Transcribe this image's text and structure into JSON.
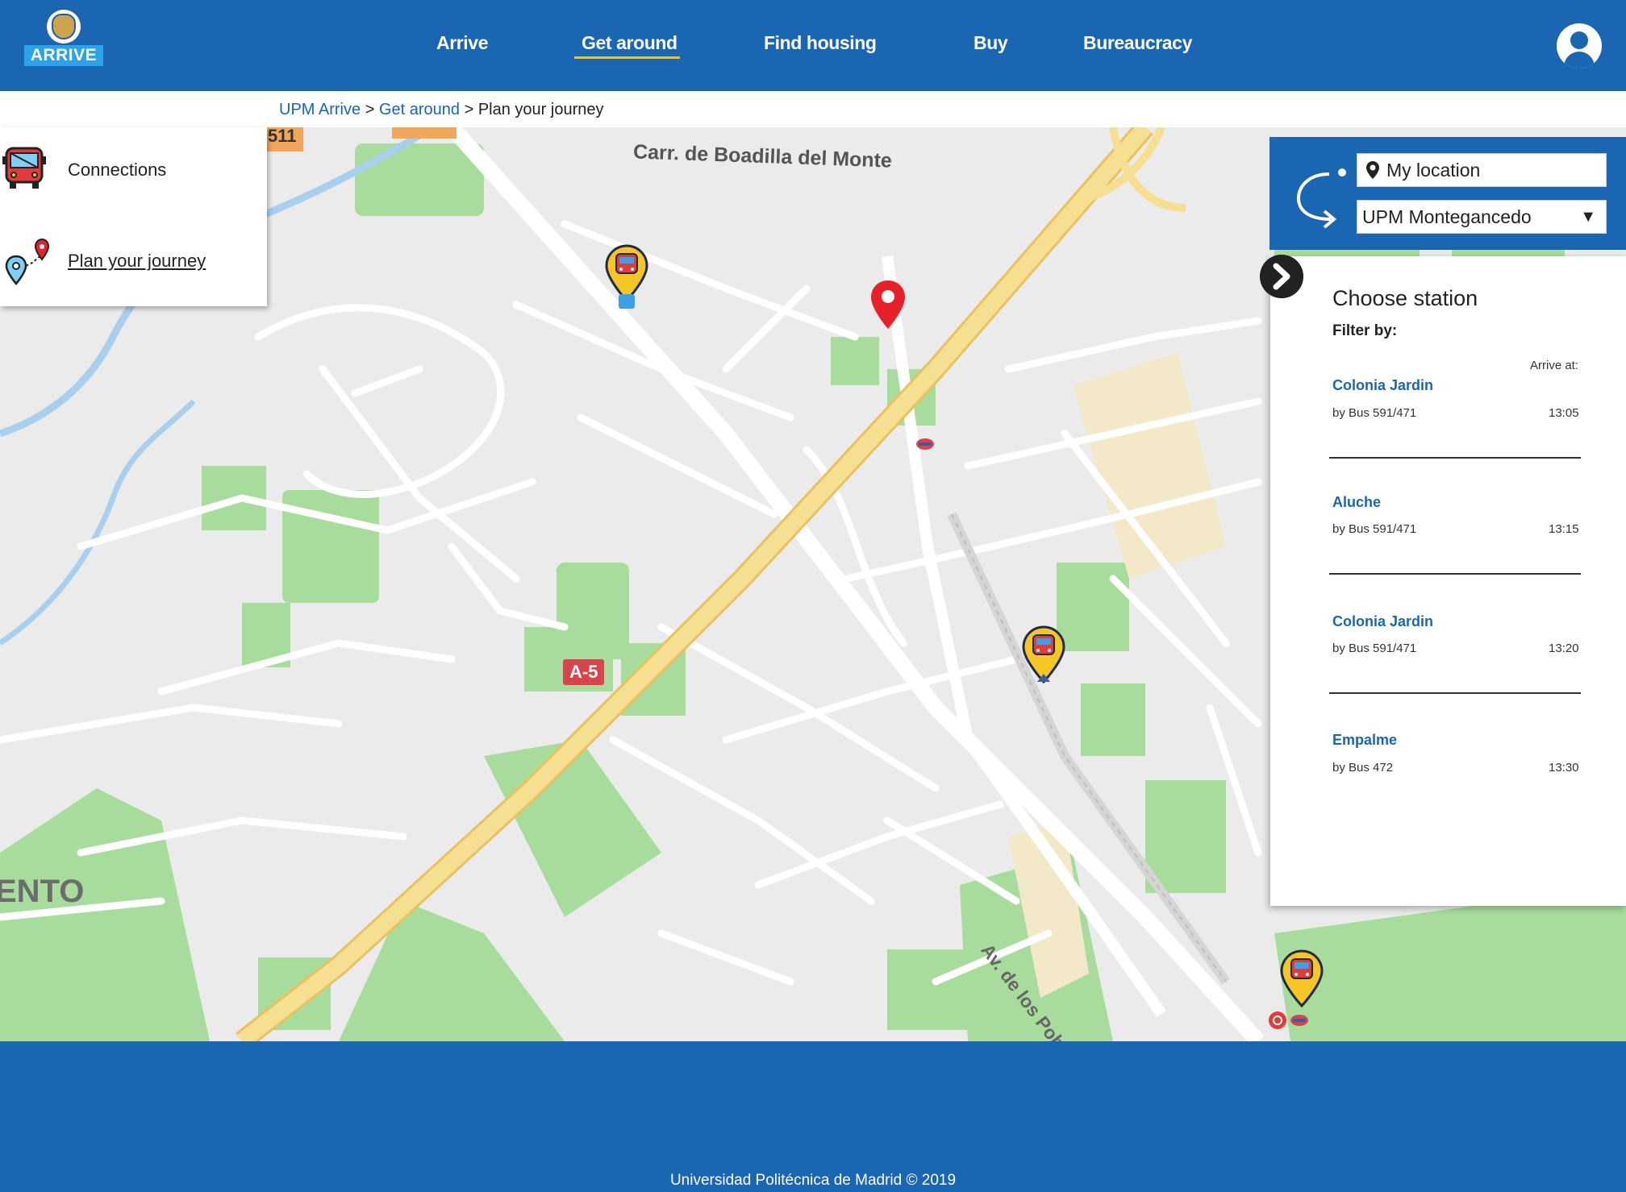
{
  "header": {
    "logo_text": "ARRIVE",
    "nav": [
      "Arrive",
      "Get around",
      "Find housing",
      "Buy",
      "Bureaucracy"
    ],
    "active_nav": "Get around"
  },
  "breadcrumb": {
    "items": [
      "UPM Arrive",
      "Get around",
      "Plan your journey"
    ],
    "separator": ">"
  },
  "left_menu": {
    "items": [
      {
        "label": "Connections",
        "icon": "bus-icon"
      },
      {
        "label": "Plan your journey",
        "icon": "route-pins-icon"
      }
    ]
  },
  "map": {
    "labels": {
      "street_top": "Carr. de Boadilla del Monte",
      "street_diag": "Av. de los Poblados",
      "area_left": "ENTO",
      "road_a5": "A-5",
      "road_511": "511"
    },
    "markers": [
      "train-station-pin-icon",
      "location-pin-icon"
    ]
  },
  "route": {
    "origin": "My location",
    "destination": "UPM Montegancedo",
    "icons": [
      "route-swap-icon",
      "map-marker-icon",
      "dropdown-caret-icon"
    ]
  },
  "stations": {
    "title": "Choose station",
    "filter_label": "Filter by:",
    "arrive_label": "Arrive at:",
    "list": [
      {
        "name": "Colonia Jardin",
        "by": "by Bus 591/471",
        "time": "13:05"
      },
      {
        "name": "Aluche",
        "by": "by Bus 591/471",
        "time": "13:15"
      },
      {
        "name": "Colonia Jardin",
        "by": "by Bus 591/471",
        "time": "13:20"
      },
      {
        "name": "Empalme",
        "by": "by Bus 472",
        "time": "13:30"
      }
    ]
  },
  "footer": {
    "copyright": "Universidad Politécnica de Madrid © 2019"
  },
  "colors": {
    "brand_blue": "#1a66b3",
    "accent_yellow": "#f0c419",
    "map_green": "#a8dc9c",
    "highway": "#f6d67a",
    "pin_red": "#e8202a"
  }
}
